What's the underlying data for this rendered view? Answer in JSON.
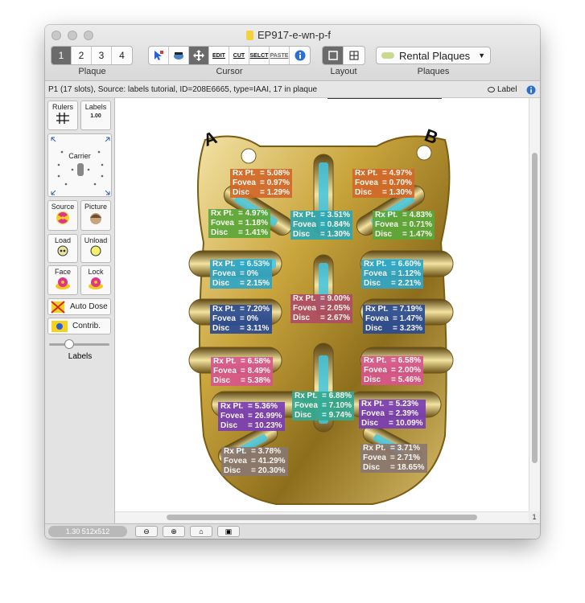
{
  "window": {
    "title": "EP917-e-wn-p-f"
  },
  "toolbar": {
    "plaque": {
      "tabs": [
        "1",
        "2",
        "3",
        "4"
      ],
      "selected": 0,
      "label": "Plaque"
    },
    "cursor": {
      "icons": [
        "select-arrow-icon",
        "reader-icon",
        "move-icon",
        "edit-icon",
        "cut-icon",
        "select-icon",
        "paste-icon",
        "info-icon"
      ],
      "edit": "EDIT",
      "cut": "CUT",
      "select": "SELCT",
      "paste": "PASTE",
      "label": "Cursor"
    },
    "layout": {
      "label": "Layout"
    },
    "plaques": {
      "value": "Rental Plaques",
      "label": "Plaques"
    }
  },
  "status": {
    "text": "P1 (17 slots), Source: labels tutorial, ID=208E6665, type=IAAI, 17 in plaque",
    "label_toggle": "Label"
  },
  "sidebar": {
    "rulers": "Rulers",
    "labels": "Labels",
    "labels_scale": "1.00",
    "carrier": "Carrier",
    "source": "Source",
    "picture": "Picture",
    "load": "Load",
    "unload": "Unload",
    "face": "Face",
    "lock": "Lock",
    "auto_dose": "Auto Dose",
    "contrib": "Contrib.",
    "slider_label": "Labels",
    "slider_value": 0.3
  },
  "plaque_marks": {
    "a": "A",
    "b": "B"
  },
  "row_labels": {
    "rx": "Rx Pt.",
    "fovea": "Fovea",
    "disc": "Disc"
  },
  "slots": [
    {
      "rx": "= 5.08%",
      "fovea": "= 0.97%",
      "disc": "= 1.29%",
      "color": "#d2692a"
    },
    {
      "rx": "= 4.97%",
      "fovea": "= 0.70%",
      "disc": "= 1.30%",
      "color": "#d2692a"
    },
    {
      "rx": "= 4.97%",
      "fovea": "= 1.18%",
      "disc": "= 1.41%",
      "color": "#5ba83a"
    },
    {
      "rx": "= 3.51%",
      "fovea": "= 0.84%",
      "disc": "= 1.30%",
      "color": "#2ea8b0"
    },
    {
      "rx": "= 4.83%",
      "fovea": "= 0.71%",
      "disc": "= 1.47%",
      "color": "#5ba83a"
    },
    {
      "rx": "= 6.53%",
      "fovea": "= 0%",
      "disc": "= 2.15%",
      "color": "#2fa6c6"
    },
    {
      "rx": "= 6.60%",
      "fovea": "= 1.12%",
      "disc": "= 2.21%",
      "color": "#2fa6c6"
    },
    {
      "rx": "= 9.00%",
      "fovea": "= 2.05%",
      "disc": "= 2.67%",
      "color": "#b04e64"
    },
    {
      "rx": "= 7.20%",
      "fovea": "= 0%",
      "disc": "= 3.11%",
      "color": "#2b4c94"
    },
    {
      "rx": "= 7.19%",
      "fovea": "= 1.47%",
      "disc": "= 3.23%",
      "color": "#2b4c94"
    },
    {
      "rx": "= 6.58%",
      "fovea": "= 8.49%",
      "disc": "= 5.38%",
      "color": "#d8568c"
    },
    {
      "rx": "= 6.58%",
      "fovea": "= 2.00%",
      "disc": "= 5.46%",
      "color": "#d8568c"
    },
    {
      "rx": "= 6.88%",
      "fovea": "= 7.10%",
      "disc": "= 9.74%",
      "color": "#32aa92"
    },
    {
      "rx": "= 5.36%",
      "fovea": "= 26.99%",
      "disc": "= 10.23%",
      "color": "#7a3eb4"
    },
    {
      "rx": "= 5.23%",
      "fovea": "= 2.39%",
      "disc": "= 10.09%",
      "color": "#7a3eb4"
    },
    {
      "rx": "= 3.78%",
      "fovea": "= 41.29%",
      "disc": "= 20.30%",
      "color": "#8a7870"
    },
    {
      "rx": "= 3.71%",
      "fovea": "= 2.71%",
      "disc": "= 18.65%",
      "color": "#8a7870"
    }
  ],
  "bottom": {
    "zoom": "1.30 512x512",
    "page": "1"
  }
}
